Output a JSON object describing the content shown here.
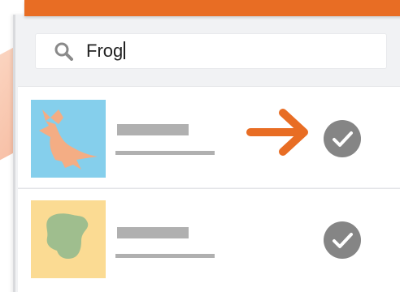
{
  "search": {
    "value": "Frog",
    "icon": "search-icon"
  },
  "results": [
    {
      "thumbnail": "bird-image",
      "selected": true,
      "thumbnail_color": "#85cfec"
    },
    {
      "thumbnail": "blob-image",
      "selected": true,
      "thumbnail_color": "#fbdb93"
    }
  ],
  "colors": {
    "accent": "#e86d24",
    "check": "#858585",
    "placeholder_lines": "#b0b0b0"
  }
}
